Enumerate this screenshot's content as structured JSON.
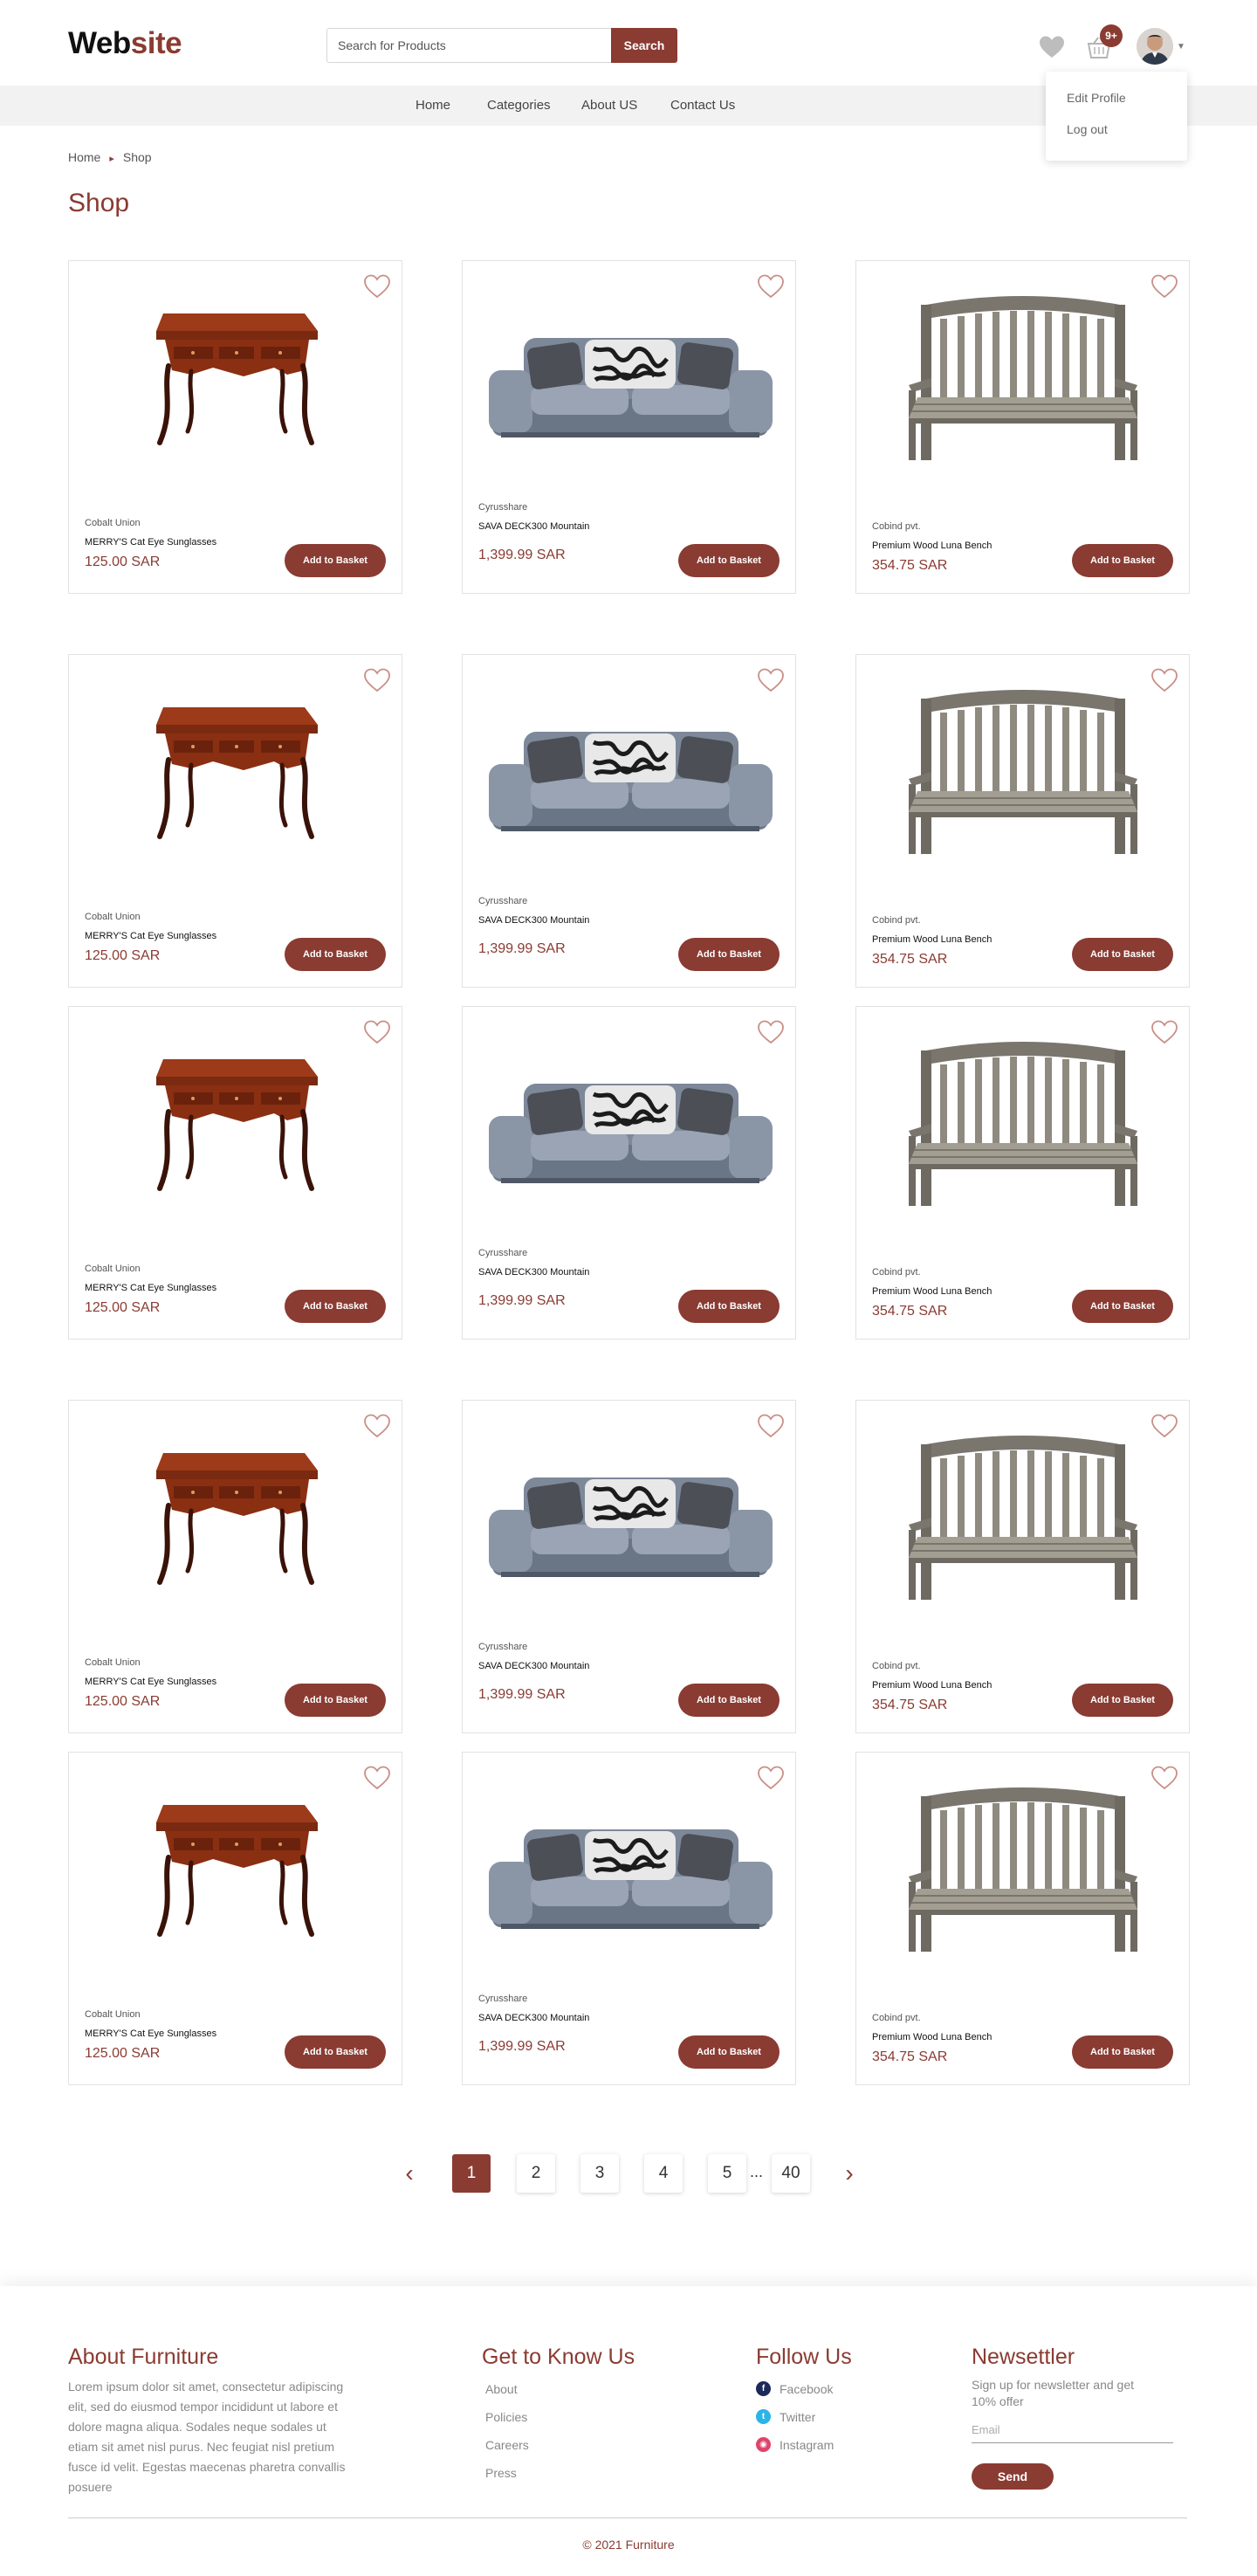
{
  "header": {
    "logo_part1": "Web",
    "logo_part2": "site",
    "search_placeholder": "Search for Products",
    "search_button": "Search",
    "basket_badge": "9+",
    "icons": [
      "heart-icon",
      "basket-icon",
      "avatar",
      "chevron-down-icon"
    ]
  },
  "nav": {
    "items": [
      "Home",
      "Categories",
      "About US",
      "Contact Us"
    ]
  },
  "profile_menu": {
    "items": [
      "Edit Profile",
      "Log out"
    ]
  },
  "breadcrumb": [
    "Home",
    "Shop"
  ],
  "page_title": "Shop",
  "products": [
    {
      "type": "table",
      "maker": "Cobalt Union",
      "name": "MERRY'S Cat Eye Sunglasses",
      "price": "125.00 SAR",
      "button": "Add to Basket"
    },
    {
      "type": "sofa",
      "maker": "Cyrusshare",
      "name": "SAVA DECK300 Mountain",
      "price": "1,399.99 SAR",
      "button": "Add to Basket"
    },
    {
      "type": "bench",
      "maker": "Cobind pvt.",
      "name": "Premium Wood Luna Bench",
      "price": "354.75 SAR",
      "button": "Add to Basket"
    },
    {
      "type": "table",
      "maker": "Cobalt Union",
      "name": "MERRY'S Cat Eye Sunglasses",
      "price": "125.00 SAR",
      "button": "Add to Basket"
    },
    {
      "type": "sofa",
      "maker": "Cyrusshare",
      "name": "SAVA DECK300 Mountain",
      "price": "1,399.99 SAR",
      "button": "Add to Basket"
    },
    {
      "type": "bench",
      "maker": "Cobind pvt.",
      "name": "Premium Wood Luna Bench",
      "price": "354.75 SAR",
      "button": "Add to Basket"
    },
    {
      "type": "table",
      "maker": "Cobalt Union",
      "name": "MERRY'S Cat Eye Sunglasses",
      "price": "125.00 SAR",
      "button": "Add to Basket"
    },
    {
      "type": "sofa",
      "maker": "Cyrusshare",
      "name": "SAVA DECK300 Mountain",
      "price": "1,399.99 SAR",
      "button": "Add to Basket"
    },
    {
      "type": "bench",
      "maker": "Cobind pvt.",
      "name": "Premium Wood Luna Bench",
      "price": "354.75 SAR",
      "button": "Add to Basket"
    },
    {
      "type": "table",
      "maker": "Cobalt Union",
      "name": "MERRY'S Cat Eye Sunglasses",
      "price": "125.00 SAR",
      "button": "Add to Basket"
    },
    {
      "type": "sofa",
      "maker": "Cyrusshare",
      "name": "SAVA DECK300 Mountain",
      "price": "1,399.99 SAR",
      "button": "Add to Basket"
    },
    {
      "type": "bench",
      "maker": "Cobind pvt.",
      "name": "Premium Wood Luna Bench",
      "price": "354.75 SAR",
      "button": "Add to Basket"
    },
    {
      "type": "table",
      "maker": "Cobalt Union",
      "name": "MERRY'S Cat Eye Sunglasses",
      "price": "125.00 SAR",
      "button": "Add to Basket"
    },
    {
      "type": "sofa",
      "maker": "Cyrusshare",
      "name": "SAVA DECK300 Mountain",
      "price": "1,399.99 SAR",
      "button": "Add to Basket"
    },
    {
      "type": "bench",
      "maker": "Cobind pvt.",
      "name": "Premium Wood Luna Bench",
      "price": "354.75 SAR",
      "button": "Add to Basket"
    }
  ],
  "pagination": {
    "prev": "‹",
    "pages": [
      "1",
      "2",
      "3",
      "4",
      "5"
    ],
    "ellipsis": "...",
    "last": "40",
    "next": "›",
    "current": "1"
  },
  "footer": {
    "about": {
      "title": "About Furniture",
      "text": "Lorem ipsum dolor sit amet, consectetur adipiscing elit, sed do eiusmod tempor incididunt ut labore et dolore magna aliqua. Sodales neque sodales ut etiam sit amet nisl purus. Nec feugiat nisl pretium fusce id velit. Egestas maecenas pharetra convallis posuere"
    },
    "know": {
      "title": "Get to Know Us",
      "links": [
        "About",
        "Policies",
        "Careers",
        "Press"
      ]
    },
    "follow": {
      "title": "Follow Us",
      "links": [
        {
          "label": "Facebook",
          "icon": "facebook-icon",
          "color": "#1a2a5a"
        },
        {
          "label": "Twitter",
          "icon": "twitter-icon",
          "color": "#2bb4e8"
        },
        {
          "label": "Instagram",
          "icon": "instagram-icon",
          "color": "#e0446a"
        }
      ]
    },
    "newsletter": {
      "title": "Newsettler",
      "text": "Sign up for newsletter and get 10% offer",
      "email_placeholder": "Email",
      "button": "Send"
    },
    "copyright": "© 2021 Furniture"
  },
  "colors": {
    "accent": "#8a3b32",
    "nav_bg": "#f2f2f2"
  }
}
